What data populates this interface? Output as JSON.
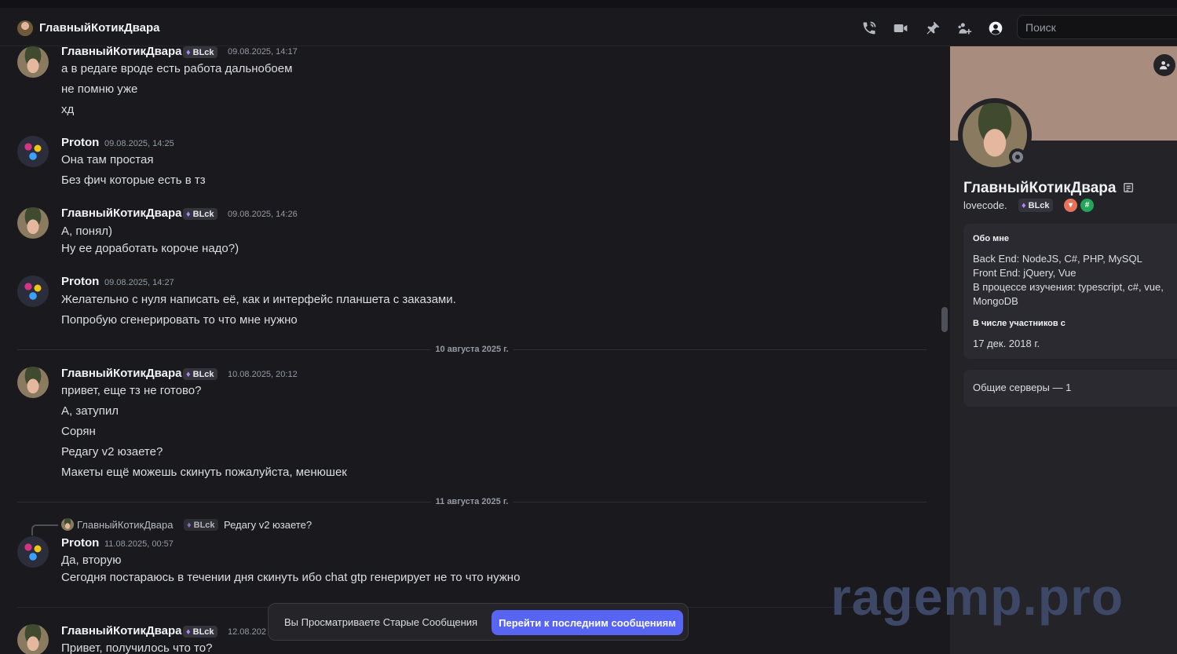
{
  "header": {
    "title": "ГлавныйКотикДвара",
    "search_placeholder": "Поиск",
    "icons": [
      "phone-call-icon",
      "video-call-icon",
      "pin-icon",
      "add-friends-icon",
      "user-profile-icon"
    ]
  },
  "messages": [
    {
      "author": "ГлавныйКотикДвара",
      "tag": "BLck",
      "time": "09.08.2025, 14:17",
      "lines": [
        "а в редаге вроде есть работа дальнобоем",
        "не помню уже",
        "хд"
      ]
    },
    {
      "author": "Proton",
      "time": "09.08.2025, 14:25",
      "lines": [
        "Она там простая",
        "Без фич которые есть в тз"
      ]
    },
    {
      "author": "ГлавныйКотикДвара",
      "tag": "BLck",
      "time": "09.08.2025, 14:26",
      "lines": [
        "А, понял)",
        "Ну ее доработать короче надо?)"
      ]
    },
    {
      "author": "Proton",
      "time": "09.08.2025, 14:27",
      "lines": [
        "Желательно с нуля написать её, как и интерфейс планшета с заказами.",
        "Попробую сгенерировать то что мне нужно"
      ]
    },
    {
      "author": "ГлавныйКотикДвара",
      "tag": "BLck",
      "time": "10.08.2025, 20:12",
      "lines": [
        "привет, еще тз не готово?",
        "А, затупил",
        "Сорян",
        "Редагу v2 юзаете?",
        "Макеты ещё можешь скинуть пожалуйста, менюшек"
      ]
    },
    {
      "author": "Proton",
      "time": "11.08.2025, 00:57",
      "lines": [
        "Да, вторую",
        "Сегодня постараюсь в течении дня скинуть ибо chat gtp генерирует не то что нужно"
      ]
    },
    {
      "author": "ГлавныйКотикДвара",
      "tag": "BLck",
      "time": "12.08.202",
      "lines": [
        "Привет, получилось что то?"
      ]
    }
  ],
  "dividers": [
    "10 августа 2025 г.",
    "11 августа 2025 г."
  ],
  "reply": {
    "author": "ГлавныйКотикДвара",
    "tag": "BLck",
    "text": "Редагу v2 юзаете?"
  },
  "jump_bar": {
    "text": "Вы Просматриваете Старые Сообщения",
    "button": "Перейти к последним сообщениям"
  },
  "watermark": "ragemp.pro",
  "profile": {
    "display_name": "ГлавныйКотикДвара",
    "username": "lovecode.",
    "tag": "BLck",
    "about_heading": "Обо мне",
    "about_lines": [
      "Back End: NodeJS, C#, PHP, MySQL",
      "Front End: jQuery, Vue",
      "В процессе изучения: typescript, c#, vue,",
      "MongoDB"
    ],
    "member_since_heading": "В числе участников с",
    "member_since": "17 дек. 2018 г.",
    "mutual_servers": "Общие серверы — 1",
    "status": "offline"
  },
  "colors": {
    "accent": "#5865f2",
    "background": "#1a1a1e",
    "panel": "#232328",
    "banner": "#a88c7e",
    "tag_flame": "#b185ff"
  }
}
